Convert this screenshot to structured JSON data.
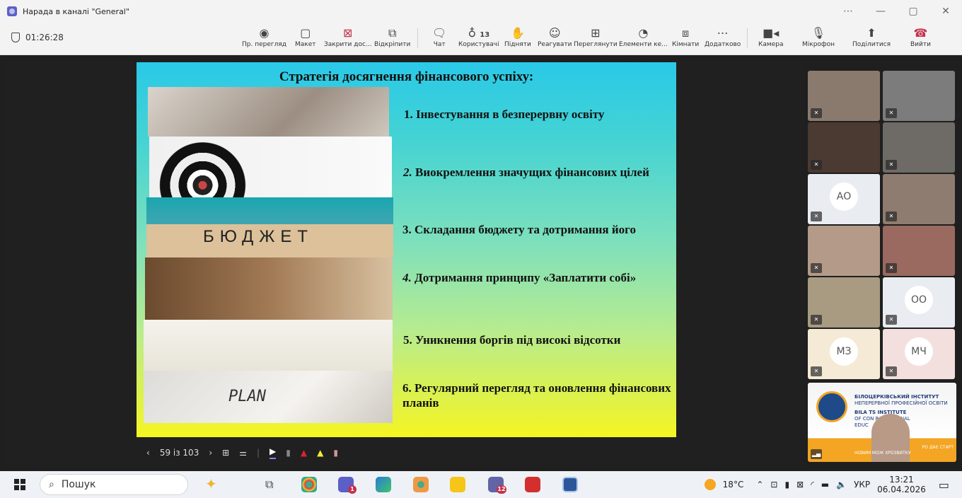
{
  "window": {
    "title": "Нарада в каналі \"General\"",
    "controls": [
      "⋯",
      "—",
      "▢",
      "✕"
    ]
  },
  "meeting": {
    "elapsed": "01:26:28"
  },
  "toolbar": {
    "view": "Пр. перегляд",
    "layout": "Макет",
    "close_share": "Закрити дос...",
    "unpin": "Відкріпити",
    "chat": "Чат",
    "people": "Користувачі",
    "people_count": "13",
    "raise": "Підняти",
    "react": "Реагувати",
    "view2": "Переглянути",
    "apps": "Елементи ке...",
    "rooms": "Кімнати",
    "more": "Додатково",
    "camera": "Камера",
    "mic": "Мікрофон",
    "share": "Поділитися",
    "leave": "Вийти"
  },
  "slide": {
    "title": "Стратегія досягнення фінансового успіху:",
    "items": [
      {
        "num": "1.",
        "text": "Інвестування в безперервну освіту"
      },
      {
        "num": "2.",
        "text": "Виокремлення значущих фінансових цілей"
      },
      {
        "num": "3.",
        "text": "Складання бюджету та дотримання його"
      },
      {
        "num": "4.",
        "text": "Дотримання принципу «Заплатити собі»"
      },
      {
        "num": "5.",
        "text": "Уникнення боргів під високі відсотки"
      },
      {
        "num": "6.",
        "text": "Регулярний перегляд та оновлення фінансових планів"
      }
    ],
    "budget_word": "БЮДЖЕТ",
    "plan_word": "PLAN"
  },
  "slide_nav": {
    "counter": "59 із 103"
  },
  "participants": [
    {
      "initials": "",
      "color": "#8a7a6e"
    },
    {
      "initials": "",
      "color": "#7c7c7c"
    },
    {
      "initials": "",
      "color": "#4a3a32"
    },
    {
      "initials": "",
      "color": "#6e6a66"
    },
    {
      "initials": "АО",
      "color": "#e9ecf1"
    },
    {
      "initials": "",
      "color": "#8e7c70"
    },
    {
      "initials": "",
      "color": "#b49a88"
    },
    {
      "initials": "",
      "color": "#9a6a60"
    },
    {
      "initials": "",
      "color": "#a89b82"
    },
    {
      "initials": "ОО",
      "color": "#e9ecf1"
    },
    {
      "initials": "МЗ",
      "color": "#f4ead6"
    },
    {
      "initials": "МЧ",
      "color": "#f3e0de"
    }
  ],
  "institute": {
    "name_ua": "БІЛОЦЕРКІВСЬКИЙ ІНСТИТУТ",
    "sub_ua": "НЕПЕРЕРВНОЇ ПРОФЕСІЙНОЇ ОСВІТИ",
    "name_en": "BILA TS INSTITUTE",
    "sub_en1": "OF CON ROFESSIONAL",
    "sub_en2": "EDUC",
    "footer1": "РО ДАЄ СТАРТ",
    "footer2": "НОВИМ МОЖ ХРОЗВИТКУ"
  },
  "taskbar": {
    "search": "Пошук",
    "temp": "18°C",
    "lang": "УКР",
    "time": "13:21",
    "date": "06.04.2026",
    "badge1": "1",
    "badge2": "12"
  }
}
